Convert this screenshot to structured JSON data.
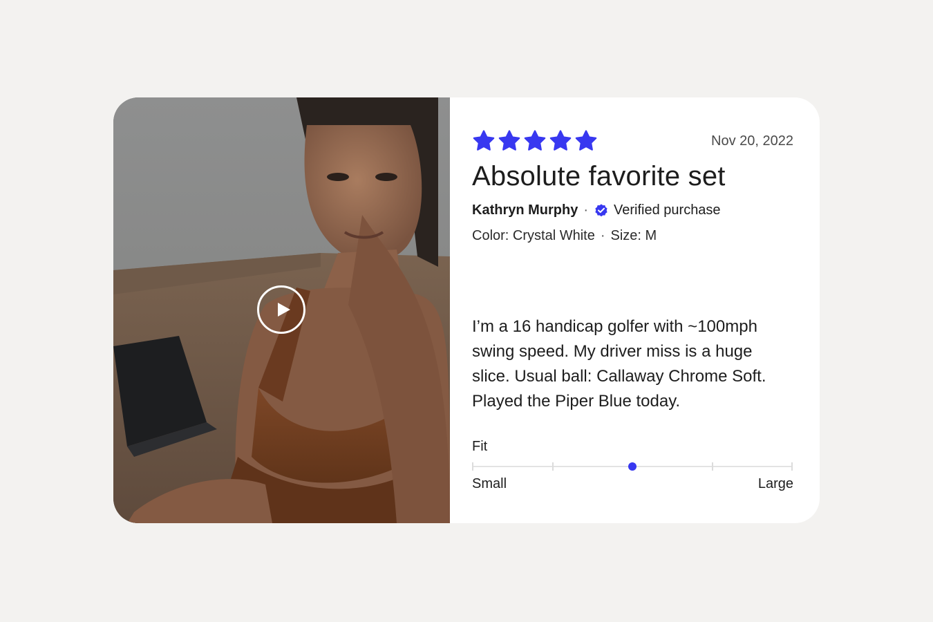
{
  "review": {
    "rating": 5,
    "rating_max": 5,
    "star_color": "#3838f0",
    "date": "Nov 20, 2022",
    "title": "Absolute favorite set",
    "author": "Kathryn Murphy",
    "separator": "·",
    "verified_label": "Verified purchase",
    "color_label": "Color: Crystal White",
    "size_label": "Size: M",
    "body": "I’m a 16 handicap golfer with ~100mph swing speed. My driver miss is a huge slice. Usual ball: Callaway Chrome Soft. Played the Piper Blue today."
  },
  "media": {
    "type": "video",
    "play_icon": "play-icon"
  },
  "fit": {
    "label": "Fit",
    "min_label": "Small",
    "max_label": "Large",
    "steps": 5,
    "value_fraction": 0.5,
    "accent_color": "#3838f0"
  }
}
